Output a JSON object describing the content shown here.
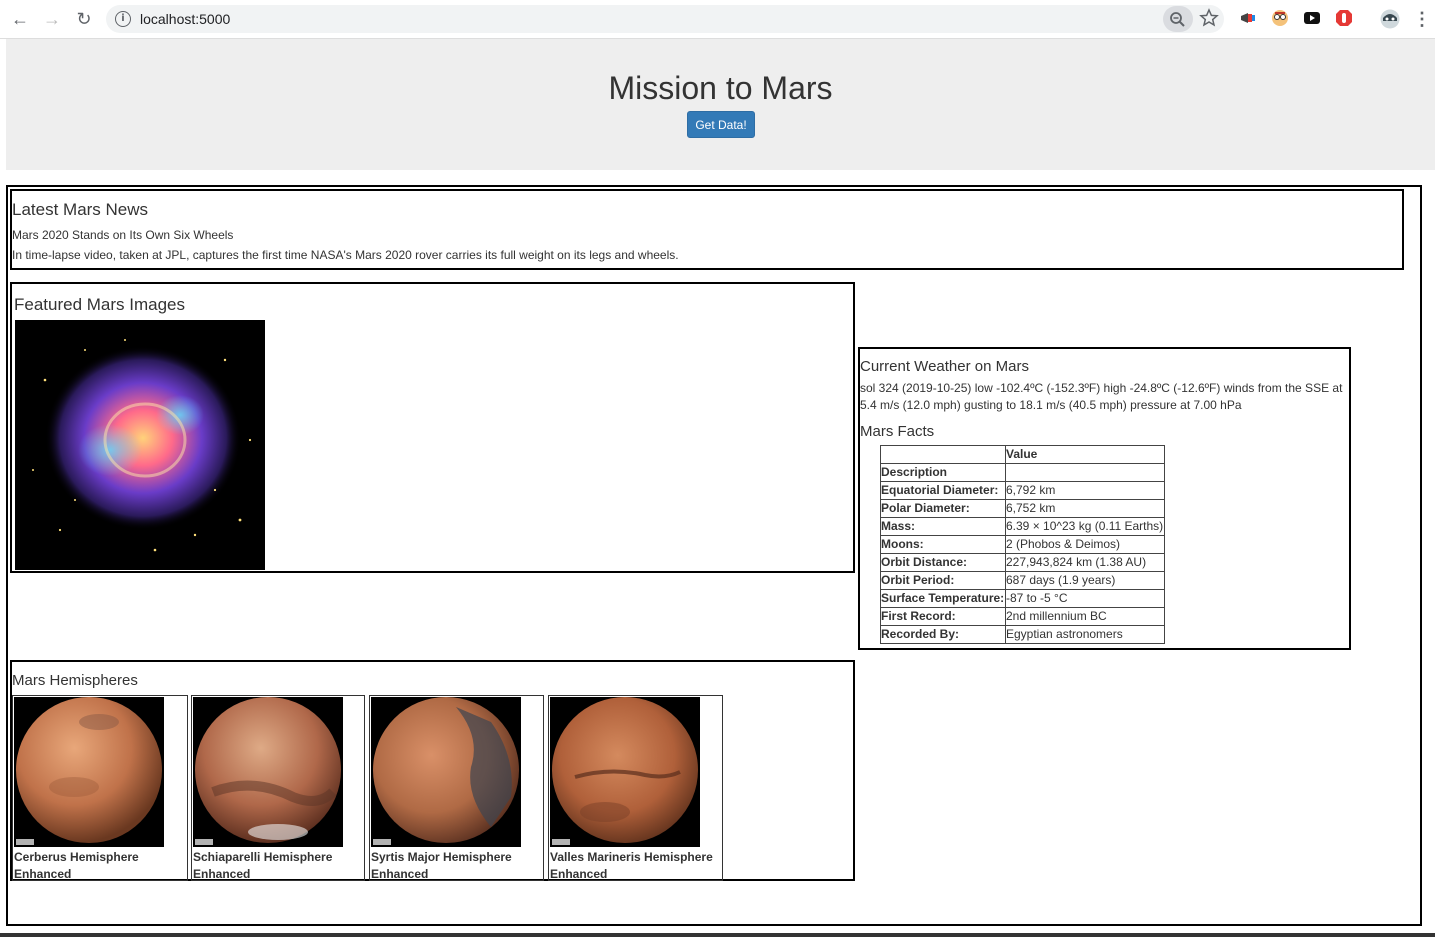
{
  "browser": {
    "url": "localhost:5000"
  },
  "header": {
    "title": "Mission to Mars",
    "button_label": "Get Data!"
  },
  "news": {
    "heading": "Latest Mars News",
    "title": "Mars 2020 Stands on Its Own Six Wheels",
    "paragraph": "In time-lapse video, taken at JPL, captures the first time NASA's Mars 2020 rover carries its full weight on its legs and wheels."
  },
  "featured": {
    "heading": "Featured Mars Images"
  },
  "weather": {
    "heading": "Current Weather on Mars",
    "text": "sol 324 (2019-10-25) low -102.4ºC (-152.3ºF) high -24.8ºC (-12.6ºF) winds from the SSE at 5.4 m/s (12.0 mph) gusting to 18.1 m/s (40.5 mph) pressure at 7.00 hPa"
  },
  "facts": {
    "heading": "Mars Facts",
    "column_header": "Value",
    "index_header": "Description",
    "rows": [
      {
        "label": "Equatorial Diameter:",
        "value": "6,792 km"
      },
      {
        "label": "Polar Diameter:",
        "value": "6,752 km"
      },
      {
        "label": "Mass:",
        "value": "6.39 × 10^23 kg (0.11 Earths)"
      },
      {
        "label": "Moons:",
        "value": "2 (Phobos & Deimos)"
      },
      {
        "label": "Orbit Distance:",
        "value": "227,943,824 km (1.38 AU)"
      },
      {
        "label": "Orbit Period:",
        "value": "687 days (1.9 years)"
      },
      {
        "label": "Surface Temperature:",
        "value": "-87 to -5 °C"
      },
      {
        "label": "First Record:",
        "value": "2nd millennium BC"
      },
      {
        "label": "Recorded By:",
        "value": "Egyptian astronomers"
      }
    ]
  },
  "hemispheres": {
    "heading": "Mars Hemispheres",
    "items": [
      {
        "title": "Cerberus Hemisphere Enhanced"
      },
      {
        "title": "Schiaparelli Hemisphere Enhanced"
      },
      {
        "title": "Syrtis Major Hemisphere Enhanced"
      },
      {
        "title": "Valles Marineris Hemisphere Enhanced"
      }
    ]
  }
}
